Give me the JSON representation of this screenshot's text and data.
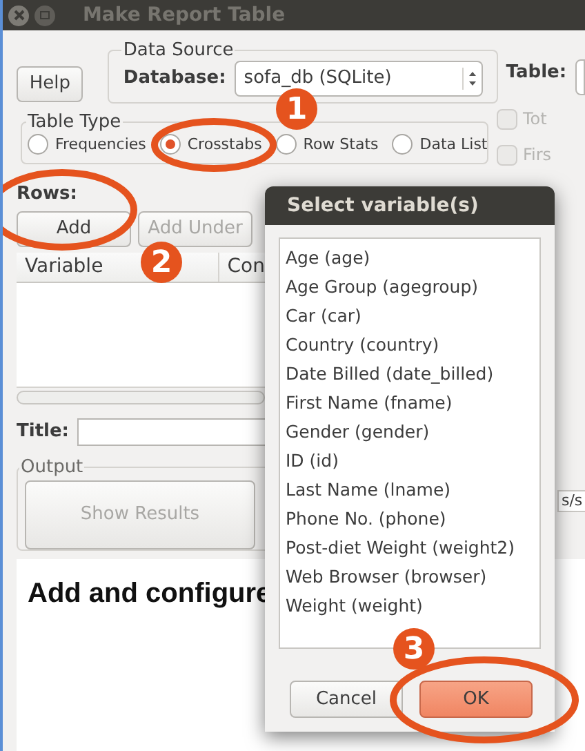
{
  "window": {
    "title": "Make Report Table"
  },
  "help_button": "Help",
  "data_source": {
    "label": "Data Source",
    "database_label": "Database:",
    "database_value": "sofa_db (SQLite)",
    "table_label": "Table:"
  },
  "table_type": {
    "label": "Table Type",
    "options": [
      {
        "label": "Frequencies",
        "selected": false
      },
      {
        "label": "Crosstabs",
        "selected": true
      },
      {
        "label": "Row Stats",
        "selected": false
      },
      {
        "label": "Data List",
        "selected": false
      }
    ]
  },
  "options": [
    {
      "label": "Tot",
      "checked": false,
      "disabled": true
    },
    {
      "label": "Firs",
      "checked": false,
      "disabled": true
    }
  ],
  "rows": {
    "label": "Rows:",
    "buttons": [
      {
        "label": "Add",
        "disabled": false
      },
      {
        "label": "Add Under",
        "disabled": true
      }
    ],
    "columns": [
      "Variable",
      "Con"
    ]
  },
  "title_label": "Title:",
  "output": {
    "label": "Output",
    "button": {
      "label": "Show Results",
      "disabled": true
    }
  },
  "side_field": "s/s",
  "preview": {
    "heading": "Add and configure"
  },
  "dialog": {
    "title": "Select variable(s)",
    "items": [
      "Age (age)",
      "Age Group (agegroup)",
      "Car (car)",
      "Country (country)",
      "Date Billed (date_billed)",
      "First Name (fname)",
      "Gender (gender)",
      "ID (id)",
      "Last Name (lname)",
      "Phone No. (phone)",
      "Post-diet Weight (weight2)",
      "Web Browser (browser)",
      "Weight (weight)"
    ],
    "buttons": [
      {
        "label": "Cancel",
        "kind": "default"
      },
      {
        "label": "OK",
        "kind": "primary"
      }
    ]
  },
  "annotations": [
    {
      "number": "1"
    },
    {
      "number": "2"
    },
    {
      "number": "3"
    }
  ]
}
